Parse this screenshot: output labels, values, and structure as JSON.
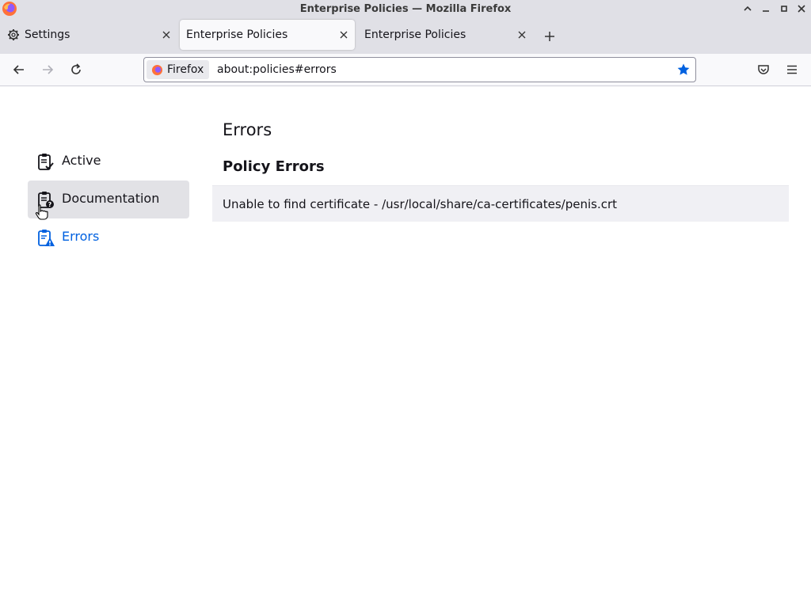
{
  "window": {
    "title": "Enterprise Policies — Mozilla Firefox"
  },
  "tabs": [
    {
      "label": "Settings",
      "icon": "gear-icon",
      "selected": false
    },
    {
      "label": "Enterprise Policies",
      "selected": true
    },
    {
      "label": "Enterprise Policies",
      "selected": false
    }
  ],
  "urlbar": {
    "identity_label": "Firefox",
    "url": "about:policies#errors"
  },
  "sidebar": {
    "items": [
      {
        "label": "Active",
        "icon": "clipboard-check-icon"
      },
      {
        "label": "Documentation",
        "icon": "clipboard-question-icon",
        "state": "hover"
      },
      {
        "label": "Errors",
        "icon": "clipboard-warning-icon",
        "state": "current"
      }
    ]
  },
  "main": {
    "title": "Errors",
    "section_title": "Policy Errors",
    "errors": [
      "Unable to find certificate - /usr/local/share/ca-certificates/penis.crt"
    ]
  },
  "colors": {
    "accent": "#0061e0",
    "tabstrip": "#e0e0e6",
    "star": "#0061e0"
  }
}
